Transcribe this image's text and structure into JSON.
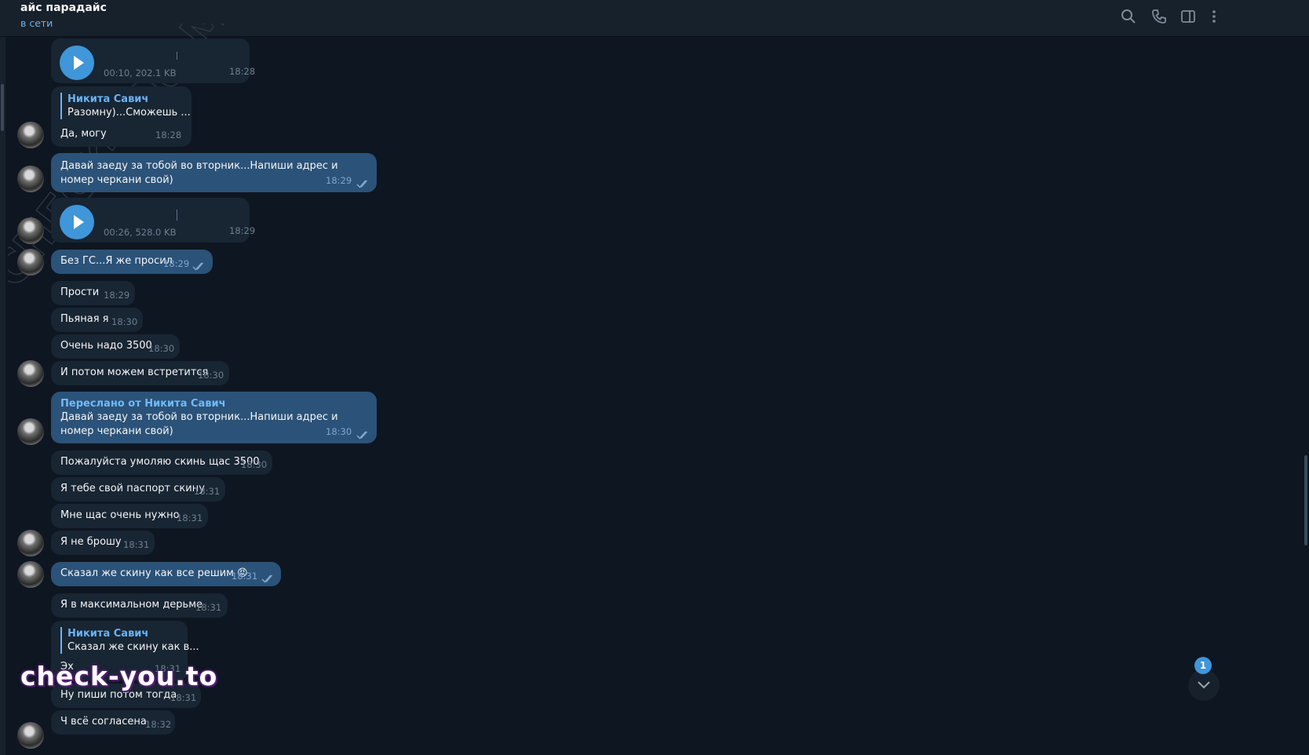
{
  "header": {
    "title": "айс парадайс",
    "status": "в сети"
  },
  "header_icons": [
    "search-icon",
    "phone-icon",
    "sidebar-toggle-icon",
    "more-vertical-icon"
  ],
  "colors": {
    "background": "#0e1621",
    "incoming_bubble": "#182533",
    "outgoing_bubble": "#2b5278",
    "accent": "#6ab2f2"
  },
  "messages": [
    {
      "kind": "voice",
      "meta": "00:10, 202.1 KB",
      "time": "18:28"
    },
    {
      "kind": "reply",
      "quote_name": "Никита Савич",
      "quote_text": "Разомну)...Сможешь ...",
      "text": "Да, могу",
      "time": "18:28"
    },
    {
      "kind": "text",
      "direction": "out",
      "text": "Давай заеду за тобой во вторник...Напиши адрес и номер черкани свой)",
      "time": "18:29"
    },
    {
      "kind": "voice",
      "meta": "00:26, 528.0 KB",
      "time": "18:29"
    },
    {
      "kind": "text",
      "direction": "out",
      "text": "Без ГС...Я же просил",
      "time": "18:29"
    },
    {
      "kind": "text",
      "direction": "in",
      "text": "Прости",
      "time": "18:29"
    },
    {
      "kind": "text",
      "direction": "in",
      "text": "Пьяная я",
      "time": "18:30"
    },
    {
      "kind": "text",
      "direction": "in",
      "text": "Очень надо 3500",
      "time": "18:30"
    },
    {
      "kind": "text",
      "direction": "in",
      "text": "И потом можем встретится",
      "time": "18:30"
    },
    {
      "kind": "forward",
      "forward_label": "Переслано от Никита Савич",
      "text": "Давай заеду за тобой во вторник...Напиши адрес и номер черкани свой)",
      "time": "18:30"
    },
    {
      "kind": "text",
      "direction": "in",
      "text": "Пожалуйста умоляю скинь щас 3500",
      "time": "18:30"
    },
    {
      "kind": "text",
      "direction": "in",
      "text": "Я тебе свой паспорт скину",
      "time": "18:31"
    },
    {
      "kind": "text",
      "direction": "in",
      "text": "Мне щас очень нужно",
      "time": "18:31"
    },
    {
      "kind": "text",
      "direction": "in",
      "text": "Я не брошу",
      "time": "18:31"
    },
    {
      "kind": "text",
      "direction": "out",
      "text": "Сказал же скину как все решим",
      "emoji": "😡",
      "time": "18:31"
    },
    {
      "kind": "text",
      "direction": "in",
      "text": "Я в максимальном дерьме",
      "time": "18:31"
    },
    {
      "kind": "reply",
      "quote_name": "Никита Савич",
      "quote_text": "Сказал же скину как в...",
      "text": "Эх",
      "time": "18:31"
    },
    {
      "kind": "text",
      "direction": "in",
      "text": "Ну пиши потом тогда",
      "time": "18:31"
    },
    {
      "kind": "text",
      "direction": "in",
      "text": "Ч всё согласена",
      "time": "18:32"
    }
  ],
  "watermark": {
    "text": "check-you.to",
    "diagonal": "CHECK-YOU.ME"
  },
  "unread_badge": "1"
}
